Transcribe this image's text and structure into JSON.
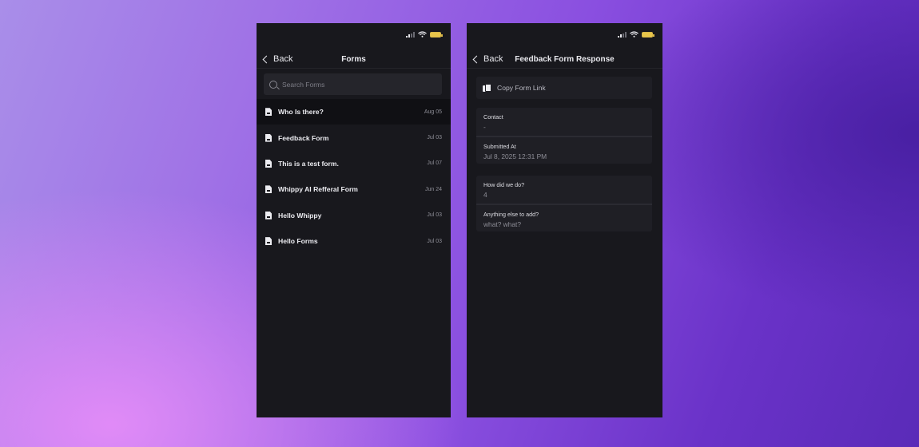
{
  "forms_screen": {
    "back_label": "Back",
    "title": "Forms",
    "search_placeholder": "Search Forms",
    "forms": [
      {
        "name": "Who Is there?",
        "date": "Aug 05"
      },
      {
        "name": "Feedback Form",
        "date": "Jul 03"
      },
      {
        "name": "This is a test form.",
        "date": "Jul 07"
      },
      {
        "name": "Whippy AI Refferal Form",
        "date": "Jun 24"
      },
      {
        "name": "Hello Whippy",
        "date": "Jul 03"
      },
      {
        "name": "Hello Forms",
        "date": "Jul 03"
      }
    ]
  },
  "response_screen": {
    "back_label": "Back",
    "title": "Feedback Form Response",
    "copy_link_label": "Copy Form Link",
    "meta": [
      {
        "label": "Contact",
        "value": "-"
      },
      {
        "label": "Submitted At",
        "value": "Jul 8, 2025 12:31 PM"
      }
    ],
    "answers": [
      {
        "label": "How did we do?",
        "value": "4"
      },
      {
        "label": "Anything else to add?",
        "value": "what? what?"
      }
    ]
  },
  "colors": {
    "phone_bg": "#18181d",
    "card_bg": "#1f1f25",
    "text": "#e9e9ee",
    "muted": "#8e8e97"
  }
}
